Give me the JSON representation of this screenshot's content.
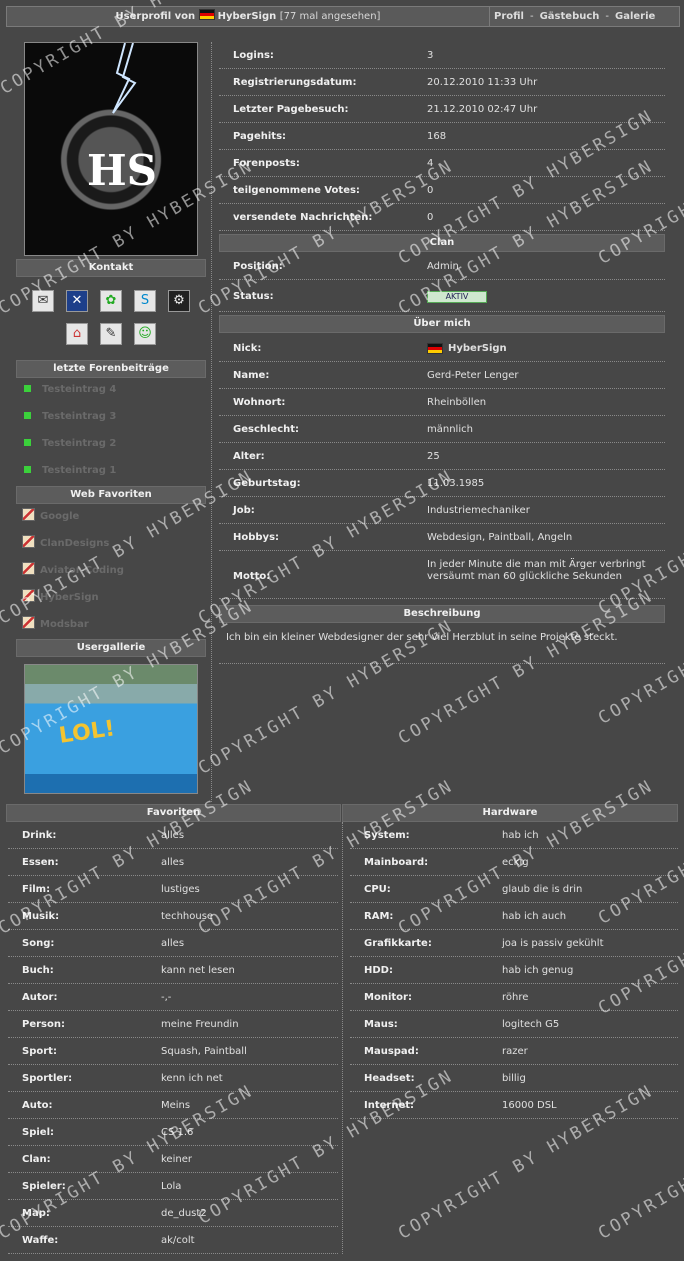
{
  "header": {
    "prefix": "Userprofil von",
    "name": "HyberSign",
    "views": "[77 mal angesehen]",
    "nav": [
      "Profil",
      "Gästebuch",
      "Galerie"
    ],
    "sep": "-"
  },
  "sidebar": {
    "kontakt_title": "Kontakt",
    "forum_title": "letzte Forenbeiträge",
    "forum_posts": [
      "Testeintrag 4",
      "Testeintrag 3",
      "Testeintrag 2",
      "Testeintrag 1"
    ],
    "fav_title": "Web Favoriten",
    "web_favs": [
      "Google",
      "ClanDesigns",
      "Aviator-Coding",
      "HyberSign",
      "Modsbar"
    ],
    "gallery_title": "Usergallerie",
    "gallery_caption": "LOL!"
  },
  "stats": [
    {
      "k": "Logins:",
      "v": "3"
    },
    {
      "k": "Registrierungsdatum:",
      "v": "20.12.2010 11:33 Uhr"
    },
    {
      "k": "Letzter Pagebesuch:",
      "v": "21.12.2010 02:47 Uhr"
    },
    {
      "k": "Pagehits:",
      "v": "168"
    },
    {
      "k": "Forenposts:",
      "v": "4"
    },
    {
      "k": "teilgenommene Votes:",
      "v": "0"
    },
    {
      "k": "versendete Nachrichten:",
      "v": "0"
    }
  ],
  "clan": {
    "title": "Clan",
    "position_label": "Position:",
    "position": "Admin",
    "status_label": "Status:",
    "status": "AKTIV"
  },
  "about": {
    "title": "Über mich",
    "rows": [
      {
        "k": "Nick:",
        "v": "HyberSign"
      },
      {
        "k": "Name:",
        "v": "Gerd-Peter Lenger"
      },
      {
        "k": "Wohnort:",
        "v": "Rheinböllen"
      },
      {
        "k": "Geschlecht:",
        "v": "männlich"
      },
      {
        "k": "Alter:",
        "v": "25"
      },
      {
        "k": "Geburtstag:",
        "v": "11.03.1985"
      },
      {
        "k": "Job:",
        "v": "Industriemechaniker"
      },
      {
        "k": "Hobbys:",
        "v": "Webdesign, Paintball, Angeln"
      }
    ],
    "motto_label": "Motto:",
    "motto": "In jeder Minute die man mit Ärger verbringt versäumt man 60 glückliche Sekunden"
  },
  "beschreibung": {
    "title": "Beschreibung",
    "text": "Ich bin ein kleiner Webdesigner der sehr viel Herzblut in seine Projekte steckt."
  },
  "favoriten": {
    "title": "Favoriten",
    "rows": [
      {
        "k": "Drink:",
        "v": "alles"
      },
      {
        "k": "Essen:",
        "v": "alles"
      },
      {
        "k": "Film:",
        "v": "lustiges"
      },
      {
        "k": "Musik:",
        "v": "techhouse"
      },
      {
        "k": "Song:",
        "v": "alles"
      },
      {
        "k": "Buch:",
        "v": "kann net lesen"
      },
      {
        "k": "Autor:",
        "v": "-,-"
      },
      {
        "k": "Person:",
        "v": "meine Freundin"
      },
      {
        "k": "Sport:",
        "v": "Squash, Paintball"
      },
      {
        "k": "Sportler:",
        "v": "kenn ich net"
      },
      {
        "k": "Auto:",
        "v": "Meins"
      },
      {
        "k": "Spiel:",
        "v": "CS 1.6"
      },
      {
        "k": "Clan:",
        "v": "keiner"
      },
      {
        "k": "Spieler:",
        "v": "Lola"
      },
      {
        "k": "Map:",
        "v": "de_dust2"
      },
      {
        "k": "Waffe:",
        "v": "ak/colt"
      }
    ]
  },
  "hardware": {
    "title": "Hardware",
    "rows": [
      {
        "k": "System:",
        "v": "hab ich"
      },
      {
        "k": "Mainboard:",
        "v": "eckig"
      },
      {
        "k": "CPU:",
        "v": "glaub die is drin"
      },
      {
        "k": "RAM:",
        "v": "hab ich auch"
      },
      {
        "k": "Grafikkarte:",
        "v": "joa is passiv gekühlt"
      },
      {
        "k": "HDD:",
        "v": "hab ich genug"
      },
      {
        "k": "Monitor:",
        "v": "röhre"
      },
      {
        "k": "Maus:",
        "v": "logitech G5"
      },
      {
        "k": "Mauspad:",
        "v": "razer"
      },
      {
        "k": "Headset:",
        "v": "billig"
      },
      {
        "k": "Internet:",
        "v": "16000 DSL"
      }
    ]
  },
  "watermark": "COPYRIGHT BY HYBERSIGN"
}
